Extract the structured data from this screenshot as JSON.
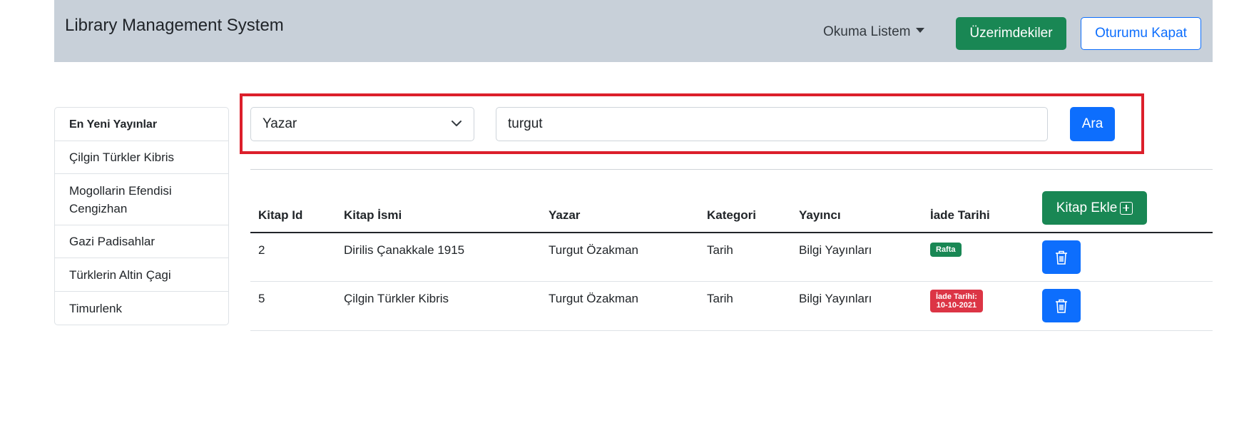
{
  "navbar": {
    "brand": "Library Management System",
    "reading_list_label": "Okuma Listem",
    "on_me_label": "Üzerimdekiler",
    "logout_label": "Oturumu Kapat"
  },
  "sidebar": {
    "items": [
      {
        "label": "En Yeni Yayınlar"
      },
      {
        "label": "Çilgin Türkler Kibris"
      },
      {
        "label": "Mogollarin Efendisi Cengizhan"
      },
      {
        "label": "Gazi Padisahlar"
      },
      {
        "label": "Türklerin Altin Çagi"
      },
      {
        "label": "Timurlenk"
      }
    ]
  },
  "search": {
    "field_select": "Yazar",
    "query_value": "turgut",
    "button_label": "Ara"
  },
  "table": {
    "add_button_label": "Kitap Ekle",
    "headers": [
      "Kitap Id",
      "Kitap İsmi",
      "Yazar",
      "Kategori",
      "Yayıncı",
      "İade Tarihi"
    ],
    "rows": [
      {
        "id": "2",
        "title": "Dirilis Çanakkale 1915",
        "author": "Turgut Özakman",
        "category": "Tarih",
        "publisher": "Bilgi Yayınları",
        "status": "Rafta",
        "status_color": "#198754"
      },
      {
        "id": "5",
        "title": "Çilgin Türkler Kibris",
        "author": "Turgut Özakman",
        "category": "Tarih",
        "publisher": "Bilgi Yayınları",
        "status_line1": "İade Tarihi:",
        "status_line2": "10-10-2021",
        "status_color": "#dc3545"
      }
    ]
  },
  "colors": {
    "navbar_bg": "#c8d0d9",
    "success": "#198754",
    "primary": "#0d6efd",
    "danger": "#dc3545",
    "highlight": "#dc1f2b"
  }
}
